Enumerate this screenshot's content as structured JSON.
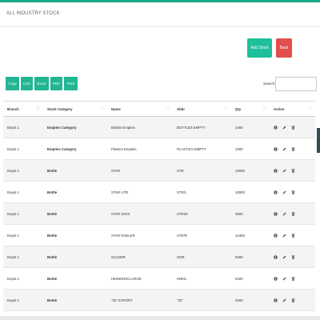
{
  "page": {
    "title": "ALL INDUSTRY STOCK"
  },
  "toolbar": {
    "add_label": "Add Stock",
    "back_label": "Back"
  },
  "exports": [
    {
      "name": "copy-button",
      "label": "Copy",
      "w": 17
    },
    {
      "name": "csv-button",
      "label": "CSV",
      "w": 15
    },
    {
      "name": "excel-button",
      "label": "Excel",
      "w": 18
    },
    {
      "name": "pdf-button",
      "label": "PDF",
      "w": 15
    },
    {
      "name": "print-button",
      "label": "Print",
      "w": 17
    }
  ],
  "search": {
    "label": "Search:",
    "value": ""
  },
  "table": {
    "columns": [
      "Branch",
      "Stock Category",
      "Name",
      "Abbr",
      "Qty",
      "Action"
    ],
    "rows": [
      [
        "Depot 1",
        "Empties Category",
        "Bottles Empties",
        "BOTTLES EMPTY",
        "1000"
      ],
      [
        "Depot 1",
        "Empties Category",
        "Plastics Empties",
        "PLASTICS EMPTY",
        "1000"
      ],
      [
        "Depot 1",
        "Bottle",
        "STAR",
        "STR",
        "10000"
      ],
      [
        "Depot 1",
        "Bottle",
        "STAR LITE",
        "STR/L",
        "10000"
      ],
      [
        "Depot 1",
        "Bottle",
        "STAR 3XXX",
        "STR3X",
        "3000"
      ],
      [
        "Depot 1",
        "Bottle",
        "STAR RADLER",
        "STR/R",
        "10400"
      ],
      [
        "Depot 1",
        "Bottle",
        "GULDER",
        "GDR",
        "9400"
      ],
      [
        "Depot 1",
        "Bottle",
        "HEINEKEN LARGE",
        "HNK/L",
        "6400"
      ],
      [
        "Depot 1",
        "Bottle",
        "\"33\" EXPORT",
        "\"33\"",
        "3400"
      ],
      [
        "Depot 1",
        "Bottle",
        "LIFE",
        "LIFE",
        "3400"
      ]
    ]
  },
  "colors": {
    "accent": "#1fbf99",
    "danger": "#e34d4d",
    "export": "#23b594"
  },
  "icons": {
    "view": "info-icon",
    "edit": "pencil-icon",
    "delete": "trash-icon"
  }
}
